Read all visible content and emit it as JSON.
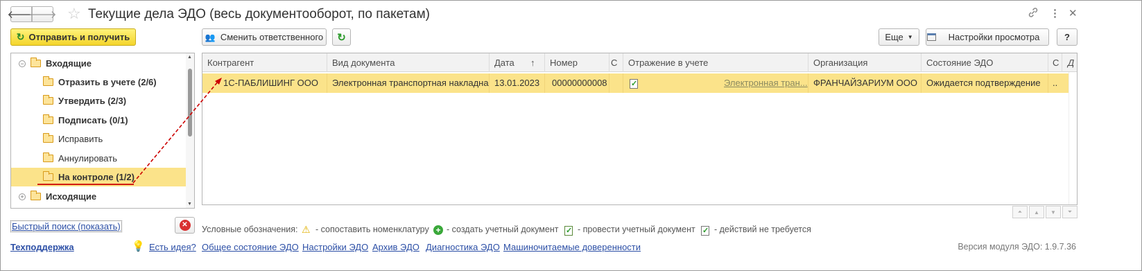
{
  "header": {
    "title": "Текущие дела ЭДО (весь документооборот, по пакетам)",
    "back_icon": "arrow-left-icon",
    "forward_icon": "arrow-right-icon",
    "favorite_icon": "star-icon"
  },
  "toolbar": {
    "send_receive": "Отправить и получить",
    "change_responsible": "Сменить ответственного",
    "more": "Еще",
    "view_settings": "Настройки просмотра",
    "help": "?"
  },
  "tree": {
    "items": [
      {
        "label": "Входящие",
        "bold": true,
        "level": 0,
        "expander": "⊖"
      },
      {
        "label": "Отразить в учете (2/6)",
        "bold": true,
        "level": 1
      },
      {
        "label": "Утвердить (2/3)",
        "bold": true,
        "level": 1
      },
      {
        "label": "Подписать (0/1)",
        "bold": true,
        "level": 1
      },
      {
        "label": "Исправить",
        "bold": false,
        "level": 1
      },
      {
        "label": "Аннулировать",
        "bold": false,
        "level": 1
      },
      {
        "label": "На контроле (1/2)",
        "bold": true,
        "level": 1,
        "selected": true
      },
      {
        "label": "Исходящие",
        "bold": true,
        "level": 0,
        "expander": "⊕"
      }
    ]
  },
  "grid": {
    "columns": [
      "Контрагент",
      "Вид документа",
      "Дата",
      "Номер",
      "С",
      "Отражение в учете",
      "Организация",
      "Состояние ЭДО",
      "С",
      "Д"
    ],
    "sort_indicator": "↑",
    "rows": [
      {
        "counterparty": "1С-ПАБЛИШИНГ ООО",
        "doc_type": "Электронная транспортная накладная",
        "date": "13.01.2023",
        "number": "00000000008",
        "accounting_link": "Электронная тран...",
        "organization": "ФРАНЧАЙЗАРИУМ ООО",
        "edo_state": "Ожидается подтверждение",
        "extra": ".."
      }
    ]
  },
  "legend": {
    "caption": "Условные обозначения:",
    "items": [
      {
        "icon": "warning-icon",
        "text": "- сопоставить номенклатуру"
      },
      {
        "icon": "plus-circle-icon",
        "text": "- создать учетный документ"
      },
      {
        "icon": "post-document-icon",
        "text": "- провести учетный документ"
      },
      {
        "icon": "no-action-document-icon",
        "text": "- действий не требуется"
      }
    ]
  },
  "footer": {
    "quick_search": "Быстрый поиск (показать)",
    "support": "Техподдержка",
    "links": [
      "Есть идея?",
      "Общее состояние ЭДО",
      "Настройки ЭДО",
      "Архив ЭДО",
      "Диагностика ЭДО",
      "Машиночитаемые доверенности"
    ],
    "version": "Версия модуля ЭДО: 1.9.7.36"
  },
  "colors": {
    "selection": "#fbe38a",
    "accent_button": "#f4d52c",
    "link": "#2c4fa6",
    "annotation": "#cc0000"
  }
}
